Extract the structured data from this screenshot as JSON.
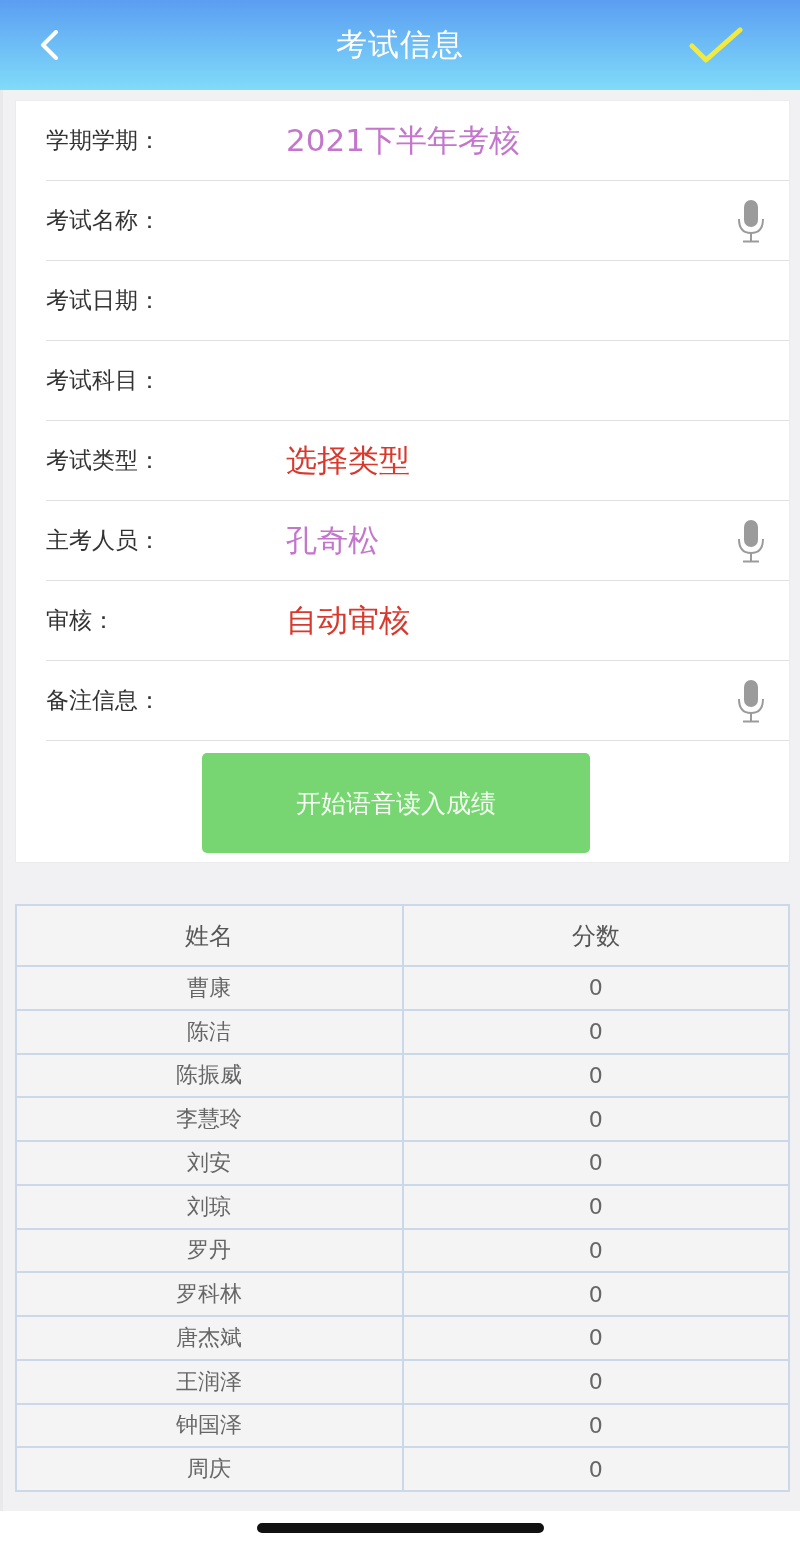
{
  "header": {
    "title": "考试信息"
  },
  "form": {
    "fields": [
      {
        "label": "学期学期：",
        "kind": "input",
        "value": "2021下半年考核",
        "voice": false
      },
      {
        "label": "考试名称：",
        "kind": "input",
        "voice": true
      },
      {
        "label": "考试日期：",
        "kind": "input",
        "voice": false
      },
      {
        "label": "考试科目：",
        "kind": "input",
        "voice": false
      },
      {
        "label": "考试类型：",
        "kind": "select",
        "value": "选择类型",
        "voice": false
      },
      {
        "label": "主考人员：",
        "kind": "input",
        "value": "孔奇松",
        "voice": true
      },
      {
        "label": "审核：",
        "kind": "select",
        "value": "自动审核",
        "voice": false
      },
      {
        "label": "备注信息：",
        "kind": "input",
        "voice": true
      }
    ],
    "voice_button": "开始语音读入成绩"
  },
  "table": {
    "columns": [
      "姓名",
      "分数"
    ],
    "rows": [
      [
        "曹康",
        "0"
      ],
      [
        "陈洁",
        "0"
      ],
      [
        "陈振威",
        "0"
      ],
      [
        "李慧玲",
        "0"
      ],
      [
        "刘安",
        "0"
      ],
      [
        "刘琼",
        "0"
      ],
      [
        "罗丹",
        "0"
      ],
      [
        "罗科林",
        "0"
      ],
      [
        "唐杰斌",
        "0"
      ],
      [
        "王润泽",
        "0"
      ],
      [
        "钟国泽",
        "0"
      ],
      [
        "周庆",
        "0"
      ]
    ]
  }
}
